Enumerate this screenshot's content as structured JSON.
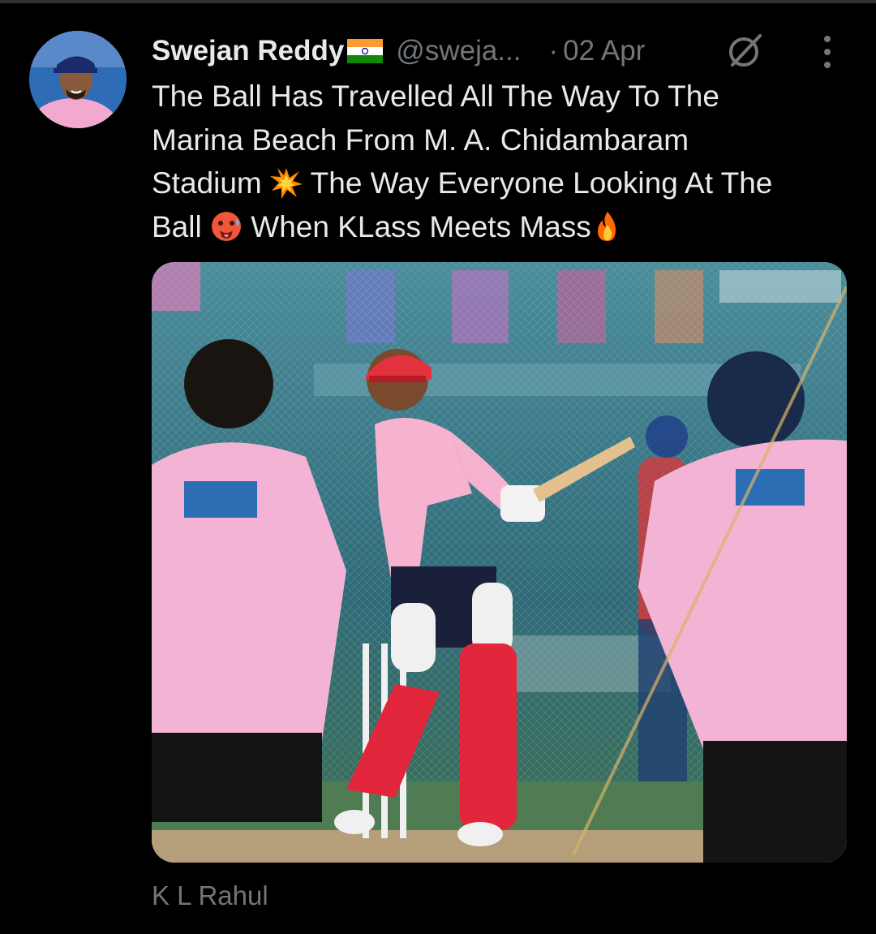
{
  "author": {
    "name": "Swejan Reddy",
    "handle": "@sweja...",
    "separator": "·",
    "date": "02 Apr"
  },
  "tweet": {
    "text_lines": [
      "The Ball Has Travelled All The Way To The",
      "Marina Beach From M. A. Chidambaram",
      "Stadium",
      "The Way Everyone Looking At The",
      "Ball",
      "When KLass Meets Mass"
    ],
    "emojis": [
      "collision",
      "hot-face",
      "fire"
    ]
  },
  "media": {
    "alt_caption": "K L Rahul",
    "accent_pink": "#f2b3d4",
    "pad_red": "#e2263b",
    "field_green": "#3c6f55"
  },
  "icons": {
    "grok": "grok-icon",
    "more": "more-vertical-icon"
  }
}
